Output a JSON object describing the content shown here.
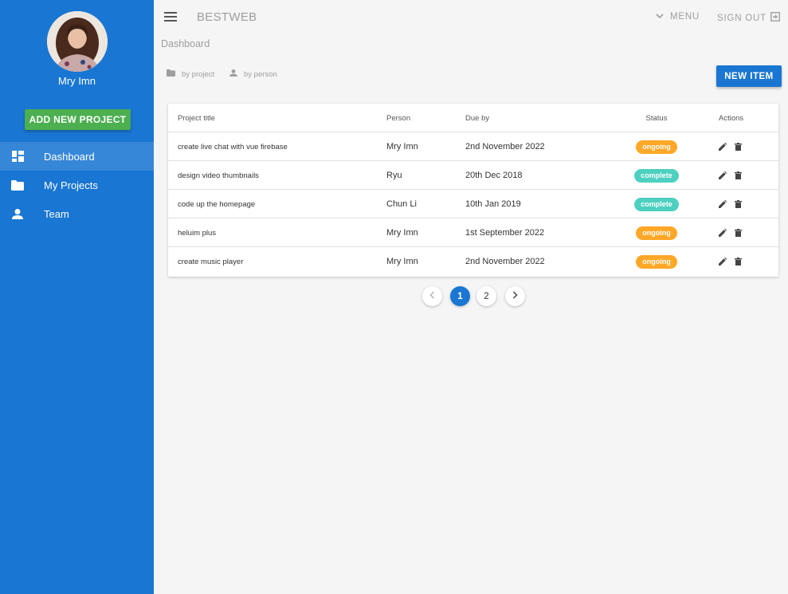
{
  "sidebar": {
    "user_name": "Mry Imn",
    "add_project_label": "ADD NEW PROJECT",
    "items": [
      {
        "label": "Dashboard",
        "icon": "dashboard-icon",
        "active": true
      },
      {
        "label": "My Projects",
        "icon": "folder-icon",
        "active": false
      },
      {
        "label": "Team",
        "icon": "person-icon",
        "active": false
      }
    ]
  },
  "topbar": {
    "brand": "BESTWEB",
    "menu_label": "MENU",
    "signout_label": "SIGN OUT"
  },
  "page": {
    "title": "Dashboard",
    "sort_by_project": "by project",
    "sort_by_person": "by person",
    "new_item_label": "NEW ITEM"
  },
  "table": {
    "headers": {
      "title": "Project title",
      "person": "Person",
      "due": "Due by",
      "status": "Status",
      "actions": "Actions"
    },
    "rows": [
      {
        "title": "create live chat with vue firebase",
        "person": "Mry Imn",
        "due": "2nd November 2022",
        "status": "ongoing"
      },
      {
        "title": "design video thumbnails",
        "person": "Ryu",
        "due": "20th Dec 2018",
        "status": "complete"
      },
      {
        "title": "code up the homepage",
        "person": "Chun Li",
        "due": "10th Jan 2019",
        "status": "complete"
      },
      {
        "title": "heluim plus",
        "person": "Mry Imn",
        "due": "1st September 2022",
        "status": "ongoing"
      },
      {
        "title": "create music player",
        "person": "Mry Imn",
        "due": "2nd November 2022",
        "status": "ongoing"
      }
    ]
  },
  "pagination": {
    "pages": [
      "1",
      "2"
    ],
    "current": "1"
  },
  "colors": {
    "primary": "#1976d2",
    "success": "#4caf50",
    "ongoing": "#ffa726",
    "complete": "#4dd0c0"
  }
}
